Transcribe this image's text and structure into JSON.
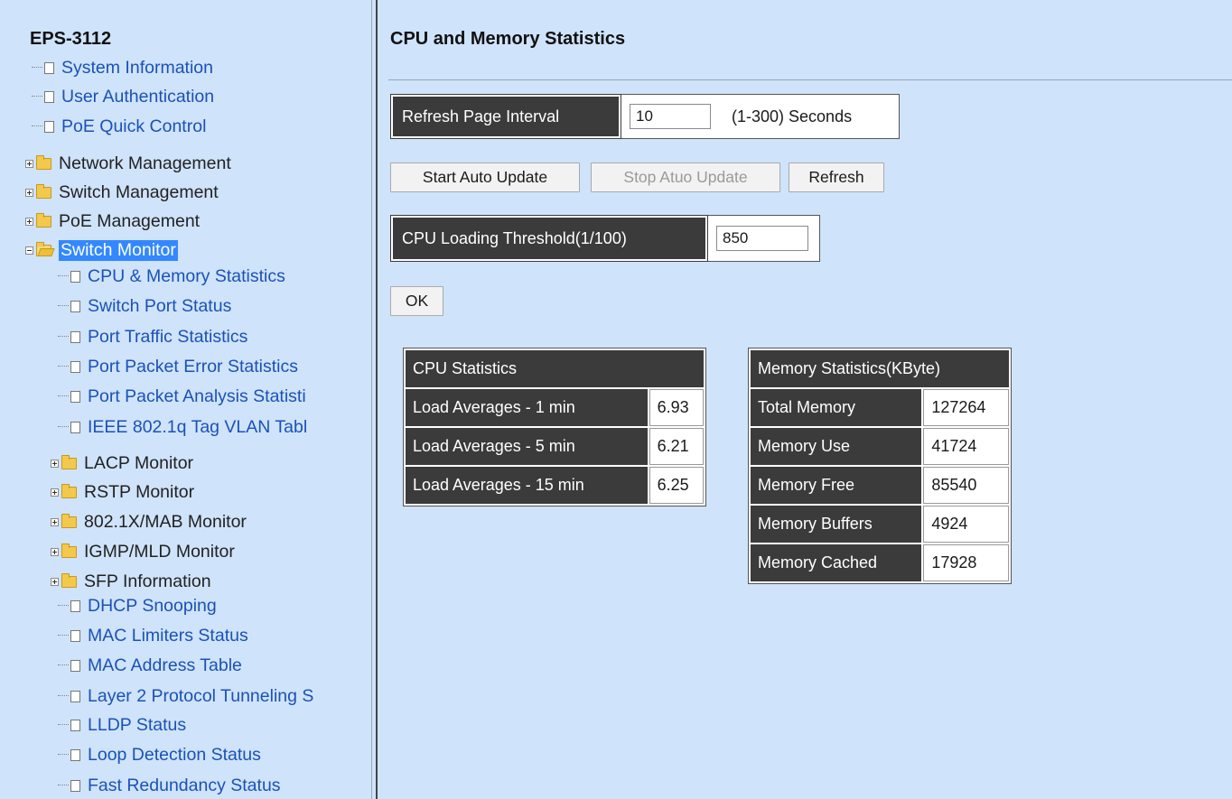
{
  "tree": {
    "title": "EPS-3112",
    "items": [
      {
        "label": "System Information",
        "kind": "page"
      },
      {
        "label": "User Authentication",
        "kind": "page"
      },
      {
        "label": "PoE Quick Control",
        "kind": "page"
      },
      {
        "label": "Network Management",
        "kind": "folder",
        "expanded": false
      },
      {
        "label": "Switch Management",
        "kind": "folder",
        "expanded": false
      },
      {
        "label": "PoE Management",
        "kind": "folder",
        "expanded": false
      },
      {
        "label": "Switch Monitor",
        "kind": "folder",
        "expanded": true,
        "selected": true
      },
      {
        "label": "CPU & Memory Statistics",
        "kind": "page"
      },
      {
        "label": "Switch Port Status",
        "kind": "page"
      },
      {
        "label": "Port Traffic Statistics",
        "kind": "page"
      },
      {
        "label": "Port Packet Error Statistics",
        "kind": "page"
      },
      {
        "label": "Port Packet Analysis Statisti",
        "kind": "page"
      },
      {
        "label": "IEEE 802.1q Tag VLAN Tabl",
        "kind": "page"
      },
      {
        "label": "LACP Monitor",
        "kind": "folder",
        "expanded": false
      },
      {
        "label": "RSTP Monitor",
        "kind": "folder",
        "expanded": false
      },
      {
        "label": "802.1X/MAB Monitor",
        "kind": "folder",
        "expanded": false
      },
      {
        "label": "IGMP/MLD Monitor",
        "kind": "folder",
        "expanded": false
      },
      {
        "label": "SFP Information",
        "kind": "folder",
        "expanded": false
      },
      {
        "label": "DHCP Snooping",
        "kind": "page"
      },
      {
        "label": "MAC Limiters Status",
        "kind": "page"
      },
      {
        "label": "MAC Address Table",
        "kind": "page"
      },
      {
        "label": "Layer 2 Protocol Tunneling S",
        "kind": "page"
      },
      {
        "label": "LLDP Status",
        "kind": "page"
      },
      {
        "label": "Loop Detection Status",
        "kind": "page"
      },
      {
        "label": "Fast Redundancy Status",
        "kind": "page"
      }
    ]
  },
  "main": {
    "title": "CPU and Memory Statistics",
    "refresh": {
      "label": "Refresh Page Interval",
      "value": "10",
      "hint": "(1-300) Seconds"
    },
    "buttons": {
      "start": "Start Auto Update",
      "stop": "Stop Atuo Update",
      "refresh": "Refresh",
      "ok": "OK"
    },
    "threshold": {
      "label": "CPU Loading Threshold(1/100)",
      "value": "850"
    },
    "cpu_stats": {
      "header": "CPU Statistics",
      "rows": [
        {
          "label": "Load Averages - 1 min",
          "value": "6.93"
        },
        {
          "label": "Load Averages - 5 min",
          "value": "6.21"
        },
        {
          "label": "Load Averages - 15 min",
          "value": "6.25"
        }
      ]
    },
    "memory_stats": {
      "header": "Memory Statistics(KByte)",
      "rows": [
        {
          "label": "Total Memory",
          "value": "127264"
        },
        {
          "label": "Memory Use",
          "value": "41724"
        },
        {
          "label": "Memory Free",
          "value": "85540"
        },
        {
          "label": "Memory Buffers",
          "value": "4924"
        },
        {
          "label": "Memory Cached",
          "value": "17928"
        }
      ]
    }
  }
}
